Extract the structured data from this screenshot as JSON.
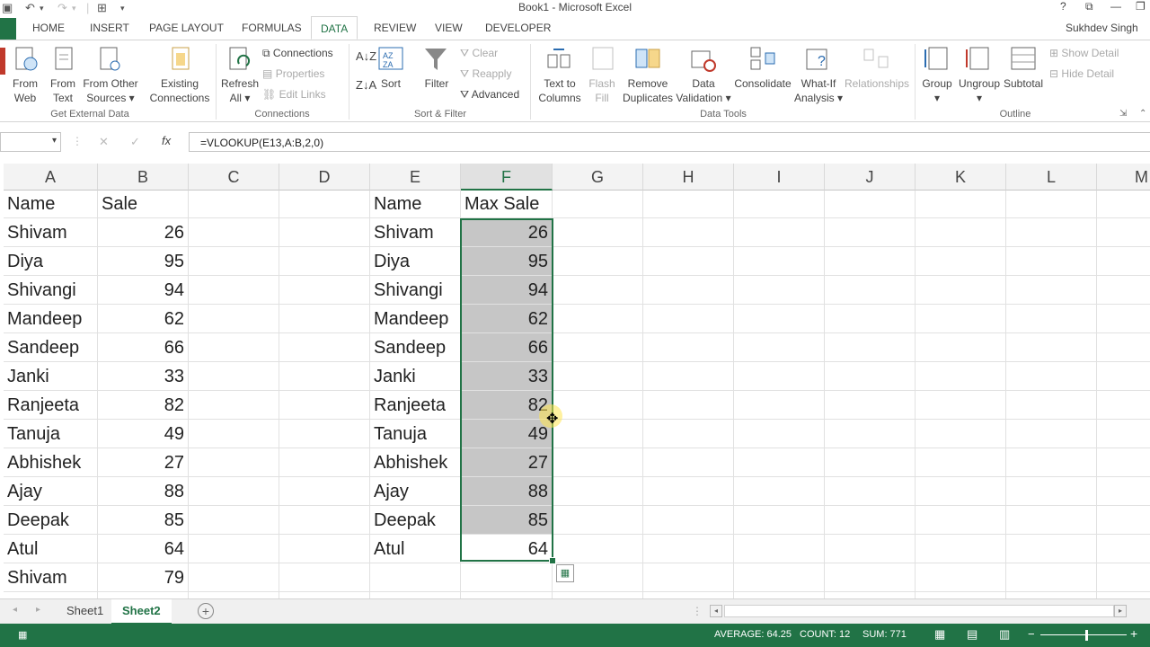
{
  "window": {
    "title": "Book1 - Microsoft Excel",
    "user": "Sukhdev Singh"
  },
  "tabs": [
    "HOME",
    "INSERT",
    "PAGE LAYOUT",
    "FORMULAS",
    "DATA",
    "REVIEW",
    "VIEW",
    "DEVELOPER"
  ],
  "active_tab": "DATA",
  "ribbon": {
    "get_external": {
      "from_web": [
        "From",
        "Web"
      ],
      "from_text": [
        "From",
        "Text"
      ],
      "from_other": [
        "From Other",
        "Sources"
      ],
      "existing": [
        "Existing",
        "Connections"
      ],
      "group": "Get External Data"
    },
    "connections": {
      "refresh": [
        "Refresh",
        "All"
      ],
      "connections": "Connections",
      "properties": "Properties",
      "edit_links": "Edit Links",
      "group": "Connections"
    },
    "sort_filter": {
      "sort": "Sort",
      "filter": "Filter",
      "clear": "Clear",
      "reapply": "Reapply",
      "advanced": "Advanced",
      "group": "Sort & Filter"
    },
    "data_tools": {
      "text_to_columns": [
        "Text to",
        "Columns"
      ],
      "flash_fill": [
        "Flash",
        "Fill"
      ],
      "remove_duplicates": [
        "Remove",
        "Duplicates"
      ],
      "data_validation": [
        "Data",
        "Validation"
      ],
      "consolidate": "Consolidate",
      "what_if": [
        "What-If",
        "Analysis"
      ],
      "relationships": "Relationships",
      "group": "Data Tools"
    },
    "outline": {
      "group_btn": "Group",
      "ungroup": "Ungroup",
      "subtotal": "Subtotal",
      "show_detail": "Show Detail",
      "hide_detail": "Hide Detail",
      "group": "Outline"
    }
  },
  "formula_bar": {
    "formula": "=VLOOKUP(E13,A:B,2,0)",
    "fx": "fx",
    "cancel": "✕",
    "confirm": "✓"
  },
  "columns": [
    "A",
    "B",
    "C",
    "D",
    "E",
    "F",
    "G",
    "H",
    "I",
    "J",
    "K",
    "L",
    "M"
  ],
  "selected_column": "F",
  "table1": {
    "headers": [
      "Name",
      "Sale"
    ],
    "rows": [
      [
        "Shivam",
        "26"
      ],
      [
        "Diya",
        "95"
      ],
      [
        "Shivangi",
        "94"
      ],
      [
        "Mandeep",
        "62"
      ],
      [
        "Sandeep",
        "66"
      ],
      [
        "Janki",
        "33"
      ],
      [
        "Ranjeeta",
        "82"
      ],
      [
        "Tanuja",
        "49"
      ],
      [
        "Abhishek",
        "27"
      ],
      [
        "Ajay",
        "88"
      ],
      [
        "Deepak",
        "85"
      ],
      [
        "Atul",
        "64"
      ],
      [
        "Shivam",
        "79"
      ]
    ]
  },
  "table2": {
    "headers": [
      "Name",
      "Max Sale"
    ],
    "rows": [
      [
        "Shivam",
        "26"
      ],
      [
        "Diya",
        "95"
      ],
      [
        "Shivangi",
        "94"
      ],
      [
        "Mandeep",
        "62"
      ],
      [
        "Sandeep",
        "66"
      ],
      [
        "Janki",
        "33"
      ],
      [
        "Ranjeeta",
        "82"
      ],
      [
        "Tanuja",
        "49"
      ],
      [
        "Abhishek",
        "27"
      ],
      [
        "Ajay",
        "88"
      ],
      [
        "Deepak",
        "85"
      ],
      [
        "Atul",
        "64"
      ]
    ]
  },
  "sheets": [
    "Sheet1",
    "Sheet2"
  ],
  "active_sheet": "Sheet2",
  "status": {
    "average": "AVERAGE: 64.25",
    "count": "COUNT: 12",
    "sum": "SUM: 771"
  },
  "colors": {
    "accent": "#217346",
    "selection": "#c6c6c6"
  }
}
